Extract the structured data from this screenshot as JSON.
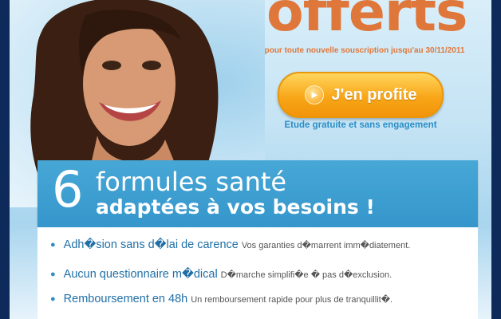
{
  "headline": {
    "word": "offerts",
    "asterisk": "*"
  },
  "subline": "pour toute nouvelle souscription jusqu'au 30/11/2011",
  "cta": {
    "label": "J'en profite",
    "icon": "play-icon",
    "note": "Etude gratuite et sans engagement"
  },
  "banner": {
    "number": "6",
    "line1": "formules santé",
    "line2": "adaptées à vos besoins !"
  },
  "features": [
    {
      "title": "Adh�sion sans d�lai de carence",
      "desc": "Vos garanties d�marrent imm�diatement."
    },
    {
      "title": "Aucun questionnaire m�dical",
      "desc": "D�marche simplifi�e � pas d�exclusion."
    },
    {
      "title": "Remboursement en 48h",
      "desc": "Un remboursement rapide pour plus de tranquillit�."
    }
  ],
  "colors": {
    "accent_orange": "#e0773a",
    "brand_blue": "#3596cc",
    "page_border": "#0d2a5a"
  }
}
